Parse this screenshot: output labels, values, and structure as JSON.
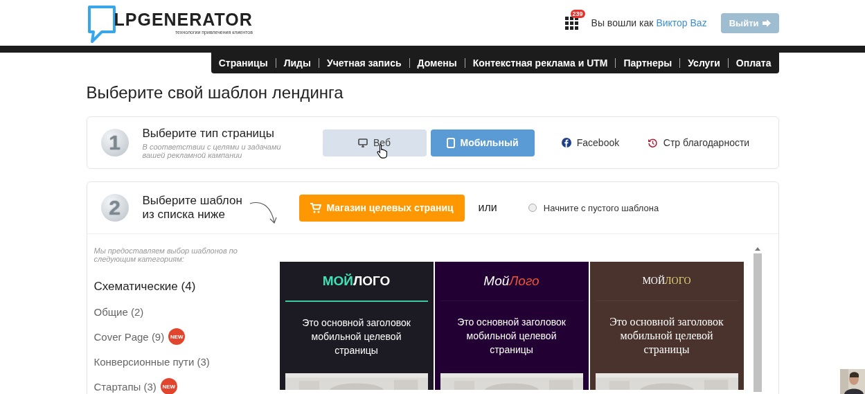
{
  "header": {
    "logo": {
      "name": "LPGENERATOR",
      "tagline": "технологии привлечения клиентов"
    },
    "notifications": "239",
    "signed_in_as": "Вы вошли как",
    "user": "Виктор Baz",
    "logout": "Выйти"
  },
  "nav": [
    "Страницы",
    "Лиды",
    "Учетная запись",
    "Домены",
    "Контекстная реклама и UTM",
    "Партнеры",
    "Услуги",
    "Оплата"
  ],
  "title": "Выберите свой шаблон лендинга",
  "step1": {
    "number": "1",
    "title": "Выберите тип страницы",
    "hint": "В соответствии с целями и задачами вашей рекламной кампании",
    "types": [
      {
        "kind": "web",
        "label": "Веб",
        "selected": false,
        "hovered": true
      },
      {
        "kind": "mobile",
        "label": "Мобильный",
        "selected": true,
        "hovered": false
      },
      {
        "kind": "facebook",
        "label": "Facebook",
        "selected": false,
        "hovered": false
      },
      {
        "kind": "thanks",
        "label": "Стр благодарности",
        "selected": false,
        "hovered": false
      }
    ]
  },
  "step2": {
    "number": "2",
    "title": "Выберите шаблон из списка ниже",
    "store_button": "Магазин целевых страниц",
    "or": "или",
    "blank": {
      "label": "Начните с пустого шаблона",
      "checked": false
    }
  },
  "categories_intro": "Мы предоставляем выбор шаблонов по следующим категориям:",
  "categories": [
    {
      "label": "Схематические (4)",
      "selected": true
    },
    {
      "label": "Общие (2)",
      "selected": false
    },
    {
      "label": "Cover Page (9)",
      "selected": false,
      "badge": "NEW"
    },
    {
      "label": "Конверсионные пути (3)",
      "selected": false
    },
    {
      "label": "Стартапы (3)",
      "selected": false,
      "badge": "NEW"
    }
  ],
  "templates": [
    {
      "color": "#1c1b24",
      "logo": [
        {
          "text": "МОЙ",
          "color": "#3ee0b5"
        },
        {
          "text": "ЛОГО",
          "color": "#ffffff"
        }
      ],
      "underline": true,
      "headline": "Это основной заголовок мобильной целевой страницы"
    },
    {
      "color": "#230033",
      "logo": [
        {
          "text": "Мой",
          "color": "#ffffff"
        },
        {
          "text": "Лого",
          "color": "#e8553a"
        }
      ],
      "underline": false,
      "headline": "Это основной заголовок мобильной целевой страницы"
    },
    {
      "color": "#4a332d",
      "logo": [
        {
          "text": "МОЙ",
          "color": "#ffffff"
        },
        {
          "text": "ЛОГО",
          "color": "#e3d07a"
        }
      ],
      "underline": false,
      "headline": "Это основной заголовок мобильной целевой страницы"
    }
  ]
}
